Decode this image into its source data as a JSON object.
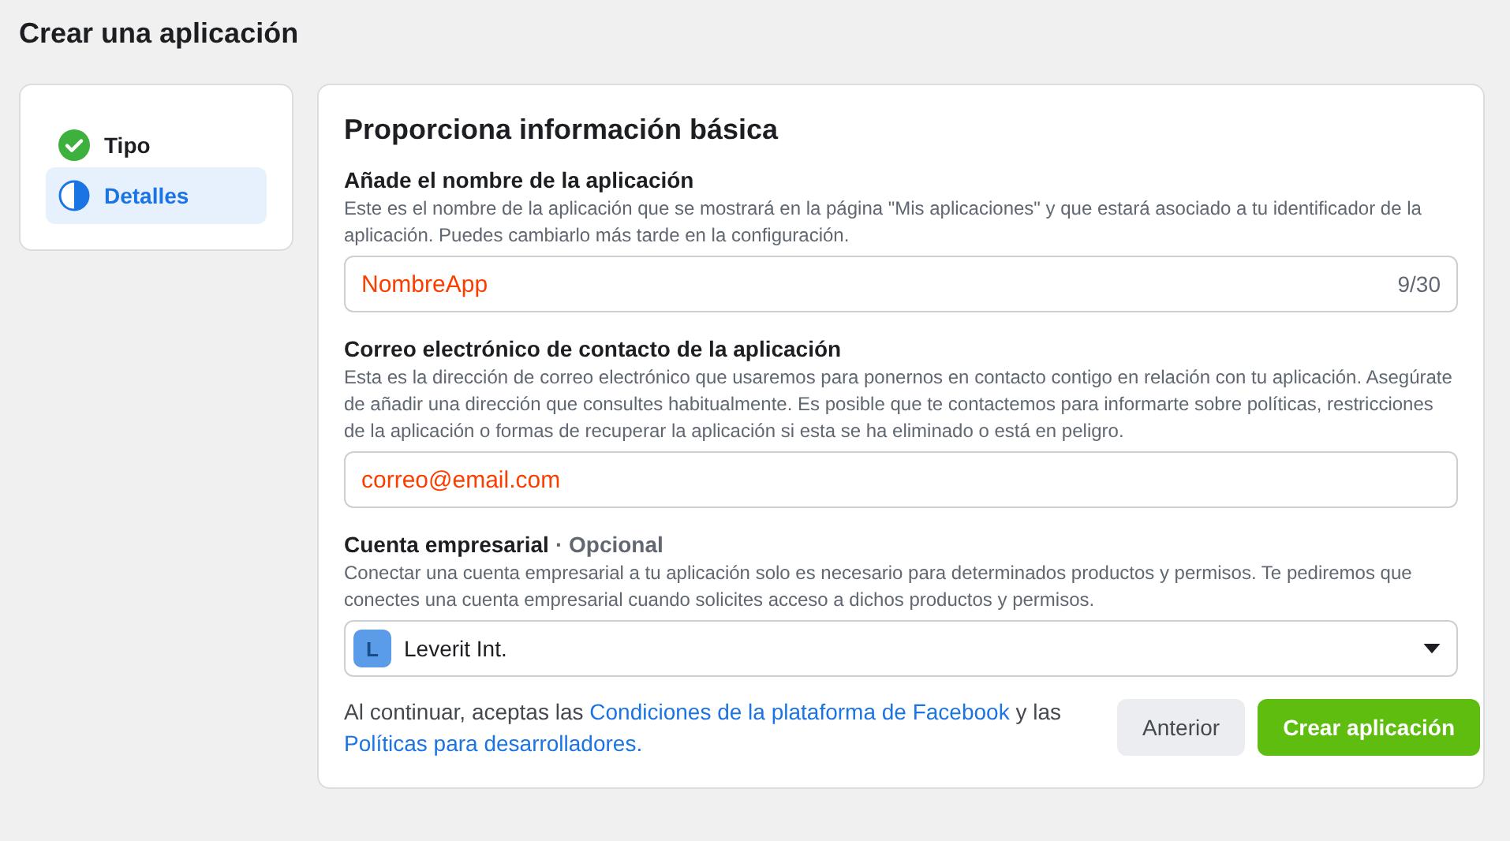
{
  "page_title": "Crear una aplicación",
  "steps": [
    {
      "label": "Tipo",
      "kind": "done",
      "selected": false
    },
    {
      "label": "Detalles",
      "kind": "current",
      "selected": true
    }
  ],
  "form": {
    "heading": "Proporciona información básica",
    "fields": [
      {
        "kind": "text",
        "label": "Añade el nombre de la aplicación",
        "help": "Este es el nombre de la aplicación que se mostrará en la página \"Mis aplicaciones\" y que estará asociado a tu identificador de la aplicación. Puedes cambiarlo más tarde en la configuración.",
        "value": "NombreApp",
        "counter": "9/30"
      },
      {
        "kind": "text",
        "label": "Correo electrónico de contacto de la aplicación",
        "help": "Esta es la dirección de correo electrónico que usaremos para ponernos en contacto contigo en relación con tu aplicación. Asegúrate de añadir una dirección que consultes habitualmente. Es posible que te contactemos para informarte sobre políticas, restricciones de la aplicación o formas de recuperar la aplicación si esta se ha eliminado o está en peligro.",
        "value": "correo@email.com"
      },
      {
        "kind": "select",
        "label": "Cuenta empresarial",
        "optional": "· Opcional",
        "help": "Conectar una cuenta empresarial a tu aplicación solo es necesario para determinados productos y permisos. Te pediremos que conectes una cuenta empresarial cuando solicites acceso a dichos productos y permisos.",
        "avatar": "L",
        "value": "Leverit Int."
      }
    ],
    "terms": [
      {
        "kind": "text",
        "text": "Al continuar, aceptas las "
      },
      {
        "kind": "link",
        "text": "Condiciones de la plataforma de Facebook"
      },
      {
        "kind": "text",
        "text": " y las "
      },
      {
        "kind": "link",
        "text": "Políticas para desarrolladores."
      }
    ],
    "buttons": [
      {
        "label": "Anterior",
        "kind": "secondary"
      },
      {
        "label": "Crear aplicación",
        "kind": "primary"
      }
    ]
  }
}
